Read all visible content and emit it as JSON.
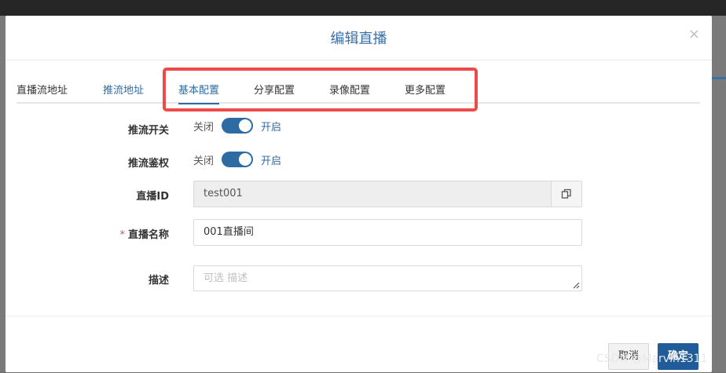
{
  "modal": {
    "title": "编辑直播",
    "close": "×"
  },
  "tabs": [
    {
      "label": "直播流地址"
    },
    {
      "label": "推流地址"
    },
    {
      "label": "基本配置"
    },
    {
      "label": "分享配置"
    },
    {
      "label": "录像配置"
    },
    {
      "label": "更多配置"
    }
  ],
  "active_tab": "基本配置",
  "form": {
    "push_switch": {
      "label": "推流开关",
      "off": "关闭",
      "on": "开启",
      "value": true
    },
    "push_auth": {
      "label": "推流鉴权",
      "off": "关闭",
      "on": "开启",
      "value": true
    },
    "live_id": {
      "label": "直播ID",
      "value": "test001"
    },
    "live_name": {
      "required_mark": "*",
      "label": "直播名称",
      "value": "001直播间"
    },
    "description": {
      "label": "描述",
      "placeholder": "可选 描述"
    }
  },
  "footer": {
    "cancel": "取消",
    "confirm": "确定"
  },
  "watermark": "CSDN @Marvin1311",
  "colors": {
    "accent": "#2f6ba3",
    "primary_button": "#1f5c99",
    "highlight_box": "#ee4a4a"
  },
  "icons": {
    "close": "close-icon",
    "copy": "copy-icon",
    "resize": "resize-grip-icon"
  }
}
